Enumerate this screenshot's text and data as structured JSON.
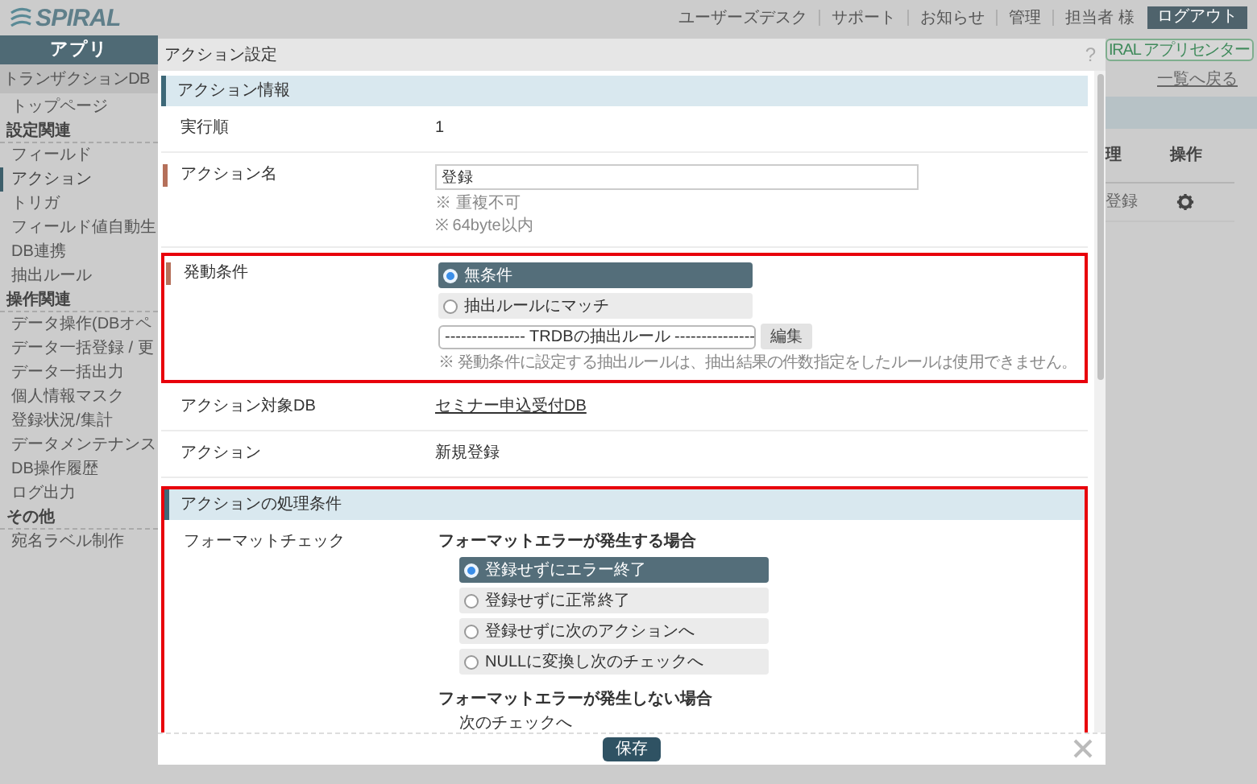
{
  "header": {
    "logo": "SPIRAL",
    "nav": [
      "ユーザーズデスク",
      "サポート",
      "お知らせ",
      "管理",
      "担当者 様"
    ],
    "logout": "ログアウト"
  },
  "sidebar": {
    "title": "アプリ",
    "db_select": "トランザクションDB",
    "top_item": {
      "label": "トップページ",
      "selected": false
    },
    "sections": [
      {
        "heading": "設定関連",
        "items": [
          {
            "label": "フィールド",
            "selected": false
          },
          {
            "label": "アクション",
            "selected": true
          },
          {
            "label": "トリガ",
            "selected": false
          },
          {
            "label": "フィールド値自動生",
            "selected": false
          },
          {
            "label": "DB連携",
            "selected": false
          },
          {
            "label": "抽出ルール",
            "selected": false
          }
        ]
      },
      {
        "heading": "操作関連",
        "items": [
          {
            "label": "データ操作(DBオペ",
            "selected": false
          },
          {
            "label": "データ一括登録 / 更",
            "selected": false
          },
          {
            "label": "データ一括出力",
            "selected": false
          },
          {
            "label": "個人情報マスク",
            "selected": false
          },
          {
            "label": "登録状況/集計",
            "selected": false
          },
          {
            "label": "データメンテナンス",
            "selected": false
          },
          {
            "label": "DB操作履歴",
            "selected": false
          },
          {
            "label": "ログ出力",
            "selected": false
          }
        ]
      },
      {
        "heading": "その他",
        "items": [
          {
            "label": "宛名ラベル制作",
            "selected": false
          }
        ]
      }
    ]
  },
  "background": {
    "app_center_badge": "IRAL アプリセンター",
    "back_link": "一覧へ戻る",
    "columns": [
      "理",
      "操作"
    ],
    "row": [
      "登録"
    ]
  },
  "modal": {
    "title": "アクション設定",
    "help": "?",
    "save": "保存",
    "sections": [
      {
        "title": "アクション情報",
        "highlighted": false,
        "rows": [
          {
            "kind": "text",
            "label": "実行順",
            "value": "1",
            "required": false,
            "highlighted": false
          },
          {
            "kind": "input",
            "label": "アクション名",
            "value": "登録",
            "required": true,
            "highlighted": false,
            "notes": [
              "※ 重複不可",
              "※ 64byte以内"
            ]
          },
          {
            "kind": "trigger",
            "label": "発動条件",
            "required": true,
            "highlighted": true,
            "options": [
              {
                "label": "無条件",
                "selected": true
              },
              {
                "label": "抽出ルールにマッチ",
                "selected": false
              }
            ],
            "select": "--------------- TRDBの抽出ルール ---------------",
            "edit_button": "編集",
            "note": "※ 発動条件に設定する抽出ルールは、抽出結果の件数指定をしたルールは使用できません。"
          },
          {
            "kind": "link",
            "label": "アクション対象DB",
            "value": "セミナー申込受付DB",
            "required": false,
            "highlighted": false
          },
          {
            "kind": "text",
            "label": "アクション",
            "value": "新規登録",
            "required": false,
            "highlighted": false
          }
        ]
      },
      {
        "title": "アクションの処理条件",
        "highlighted": true,
        "rows": [
          {
            "kind": "format",
            "label": "フォーマットチェック",
            "required": false,
            "highlighted": false,
            "groups": [
              {
                "heading": "フォーマットエラーが発生する場合",
                "options": [
                  {
                    "label": "登録せずにエラー終了",
                    "selected": true
                  },
                  {
                    "label": "登録せずに正常終了",
                    "selected": false
                  },
                  {
                    "label": "登録せずに次のアクションへ",
                    "selected": false
                  },
                  {
                    "label": "NULLに変換し次のチェックへ",
                    "selected": false
                  }
                ]
              },
              {
                "heading": "フォーマットエラーが発生しない場合",
                "value": "次のチェックへ"
              }
            ]
          }
        ]
      }
    ]
  }
}
